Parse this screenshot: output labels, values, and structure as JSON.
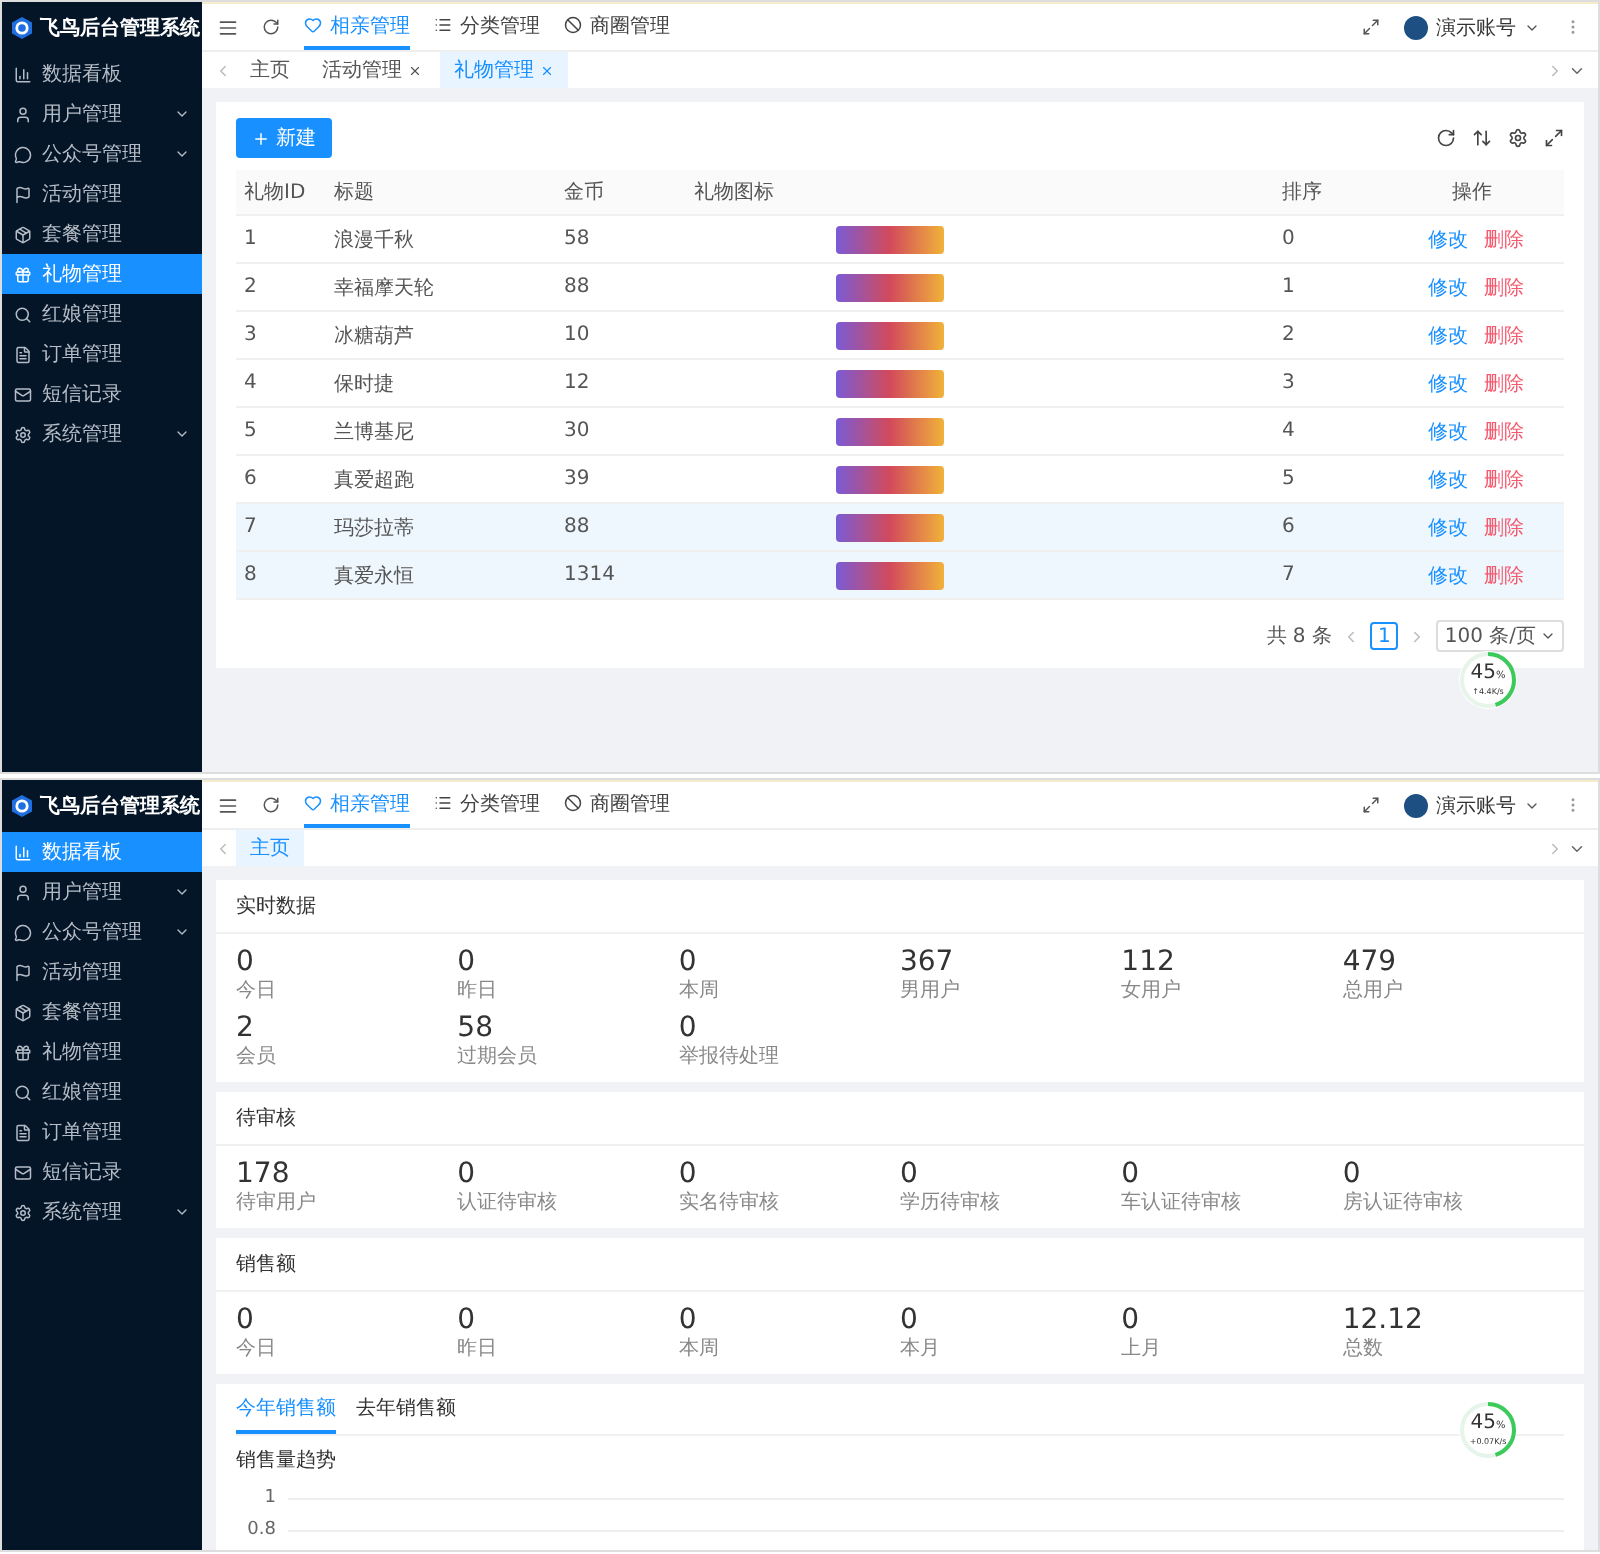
{
  "screens": [
    {
      "kind": "gift_list",
      "brand": "飞鸟后台管理系统",
      "sidebar": [
        {
          "label": "数据看板",
          "expandable": false,
          "selected": false
        },
        {
          "label": "用户管理",
          "expandable": true,
          "selected": false
        },
        {
          "label": "公众号管理",
          "expandable": true,
          "selected": false
        },
        {
          "label": "活动管理",
          "expandable": false,
          "selected": false
        },
        {
          "label": "套餐管理",
          "expandable": false,
          "selected": false
        },
        {
          "label": "礼物管理",
          "expandable": false,
          "selected": true
        },
        {
          "label": "红娘管理",
          "expandable": false,
          "selected": false
        },
        {
          "label": "订单管理",
          "expandable": false,
          "selected": false
        },
        {
          "label": "短信记录",
          "expandable": false,
          "selected": false
        },
        {
          "label": "系统管理",
          "expandable": true,
          "selected": false
        }
      ],
      "nav": [
        {
          "label": "相亲管理",
          "selected": true
        },
        {
          "label": "分类管理",
          "selected": false
        },
        {
          "label": "商圈管理",
          "selected": false
        }
      ],
      "user": "演示账号",
      "tabs": [
        {
          "label": "主页",
          "closable": false,
          "selected": false
        },
        {
          "label": "活动管理",
          "closable": true,
          "selected": false
        },
        {
          "label": "礼物管理",
          "closable": true,
          "selected": true
        }
      ],
      "new_button": "新建",
      "table": {
        "columns": [
          "礼物ID",
          "标题",
          "金币",
          "礼物图标",
          "排序",
          "操作"
        ],
        "rows": [
          {
            "id": "1",
            "title": "浪漫千秋",
            "coins": "58",
            "order": "0",
            "actions": [
              "修改",
              "删除"
            ],
            "highlighted": false
          },
          {
            "id": "2",
            "title": "幸福摩天轮",
            "coins": "88",
            "order": "1",
            "actions": [
              "修改",
              "删除"
            ],
            "highlighted": false
          },
          {
            "id": "3",
            "title": "冰糖葫芦",
            "coins": "10",
            "order": "2",
            "actions": [
              "修改",
              "删除"
            ],
            "highlighted": false
          },
          {
            "id": "4",
            "title": "保时捷",
            "coins": "12",
            "order": "3",
            "actions": [
              "修改",
              "删除"
            ],
            "highlighted": false
          },
          {
            "id": "5",
            "title": "兰博基尼",
            "coins": "30",
            "order": "4",
            "actions": [
              "修改",
              "删除"
            ],
            "highlighted": false
          },
          {
            "id": "6",
            "title": "真爱超跑",
            "coins": "39",
            "order": "5",
            "actions": [
              "修改",
              "删除"
            ],
            "highlighted": false
          },
          {
            "id": "7",
            "title": "玛莎拉蒂",
            "coins": "88",
            "order": "6",
            "actions": [
              "修改",
              "删除"
            ],
            "highlighted": true
          },
          {
            "id": "8",
            "title": "真爱永恒",
            "coins": "1314",
            "order": "7",
            "actions": [
              "修改",
              "删除"
            ],
            "highlighted": true
          }
        ]
      },
      "pagination": {
        "total": "共 8 条",
        "pages": [
          {
            "label": "1",
            "selected": true
          }
        ],
        "page_size": "100 条/页"
      },
      "speed_widget": {
        "percent": "45",
        "unit": "%",
        "rate": "↑4.4K/s",
        "level": 0.45
      }
    },
    {
      "kind": "dashboard",
      "brand": "飞鸟后台管理系统",
      "sidebar": [
        {
          "label": "数据看板",
          "expandable": false,
          "selected": true
        },
        {
          "label": "用户管理",
          "expandable": true,
          "selected": false
        },
        {
          "label": "公众号管理",
          "expandable": true,
          "selected": false
        },
        {
          "label": "活动管理",
          "expandable": false,
          "selected": false
        },
        {
          "label": "套餐管理",
          "expandable": false,
          "selected": false
        },
        {
          "label": "礼物管理",
          "expandable": false,
          "selected": false
        },
        {
          "label": "红娘管理",
          "expandable": false,
          "selected": false
        },
        {
          "label": "订单管理",
          "expandable": false,
          "selected": false
        },
        {
          "label": "短信记录",
          "expandable": false,
          "selected": false
        },
        {
          "label": "系统管理",
          "expandable": true,
          "selected": false
        }
      ],
      "nav": [
        {
          "label": "相亲管理",
          "selected": true
        },
        {
          "label": "分类管理",
          "selected": false
        },
        {
          "label": "商圈管理",
          "selected": false
        }
      ],
      "user": "演示账号",
      "tabs": [
        {
          "label": "主页",
          "closable": false,
          "selected": true
        }
      ],
      "sections": [
        {
          "title": "实时数据",
          "stats": [
            {
              "value": "0",
              "label": "今日"
            },
            {
              "value": "0",
              "label": "昨日"
            },
            {
              "value": "0",
              "label": "本周"
            },
            {
              "value": "367",
              "label": "男用户"
            },
            {
              "value": "112",
              "label": "女用户"
            },
            {
              "value": "479",
              "label": "总用户"
            },
            {
              "value": "2",
              "label": "会员"
            },
            {
              "value": "58",
              "label": "过期会员"
            },
            {
              "value": "0",
              "label": "举报待处理"
            }
          ]
        },
        {
          "title": "待审核",
          "stats": [
            {
              "value": "178",
              "label": "待审用户"
            },
            {
              "value": "0",
              "label": "认证待审核"
            },
            {
              "value": "0",
              "label": "实名待审核"
            },
            {
              "value": "0",
              "label": "学历待审核"
            },
            {
              "value": "0",
              "label": "车认证待审核"
            },
            {
              "value": "0",
              "label": "房认证待审核"
            }
          ]
        },
        {
          "title": "销售额",
          "stats": [
            {
              "value": "0",
              "label": "今日"
            },
            {
              "value": "0",
              "label": "昨日"
            },
            {
              "value": "0",
              "label": "本周"
            },
            {
              "value": "0",
              "label": "本月"
            },
            {
              "value": "0",
              "label": "上月"
            },
            {
              "value": "12.12",
              "label": "总数"
            }
          ]
        }
      ],
      "chart_card": {
        "tabs": [
          {
            "label": "今年销售额",
            "selected": true
          },
          {
            "label": "去年销售额",
            "selected": false
          }
        ],
        "title": "销售量趋势",
        "y_labels": [
          "1",
          "0.8"
        ]
      },
      "speed_widget": {
        "percent": "45",
        "unit": "%",
        "rate": "+0.07K/s",
        "level": 0.45
      }
    }
  ]
}
